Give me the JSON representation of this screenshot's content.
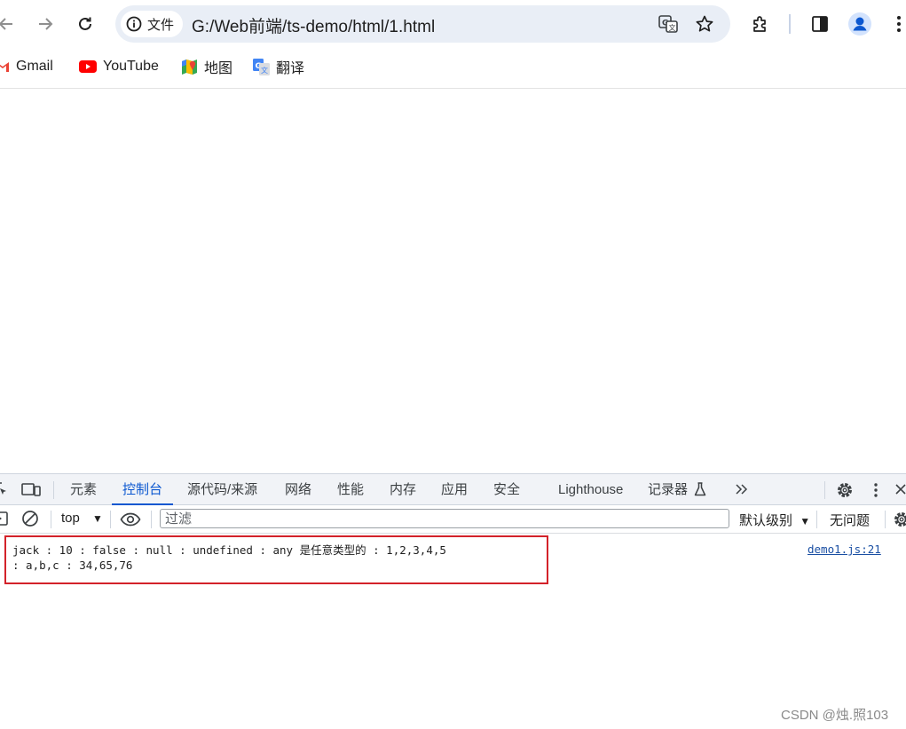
{
  "browser": {
    "site_info_label": "文件",
    "url": "G:/Web前端/ts-demo/html/1.html",
    "icons": [
      "back-arrow-icon",
      "forward-arrow-icon",
      "reload-icon",
      "info-icon",
      "translate-icon",
      "star-icon",
      "extensions-puzzle-icon",
      "side-panel-icon",
      "profile-avatar-icon",
      "more-vertical-icon"
    ]
  },
  "bookmarks": [
    {
      "label": "Gmail",
      "icon": "gmail-icon"
    },
    {
      "label": "YouTube",
      "icon": "youtube-icon"
    },
    {
      "label": "地图",
      "icon": "maps-icon"
    },
    {
      "label": "翻译",
      "icon": "google-translate-icon"
    }
  ],
  "devtools": {
    "tabs": [
      {
        "label": "元素",
        "active": false
      },
      {
        "label": "控制台",
        "active": true
      },
      {
        "label": "源代码/来源",
        "active": false
      },
      {
        "label": "网络",
        "active": false
      },
      {
        "label": "性能",
        "active": false
      },
      {
        "label": "内存",
        "active": false
      },
      {
        "label": "应用",
        "active": false
      },
      {
        "label": "安全",
        "active": false
      },
      {
        "label": "Lighthouse",
        "active": false
      },
      {
        "label": "记录器",
        "active": false
      }
    ],
    "console": {
      "context": "top",
      "filter_placeholder": "过滤",
      "levels": "默认级别",
      "issues": "无问题"
    },
    "log": {
      "line1": "jack : 10 : false : null : undefined : any 是任意类型的 : 1,2,3,4,5",
      "line2": ": a,b,c : 34,65,76",
      "source": "demo1.js:21"
    }
  },
  "watermark": "CSDN @烛.照103",
  "colors": {
    "accent": "#0b57d0",
    "highlight_border": "#d3222a",
    "omnibox_bg": "#e9eef6",
    "devtools_tab_bg": "#f1f3f7"
  }
}
